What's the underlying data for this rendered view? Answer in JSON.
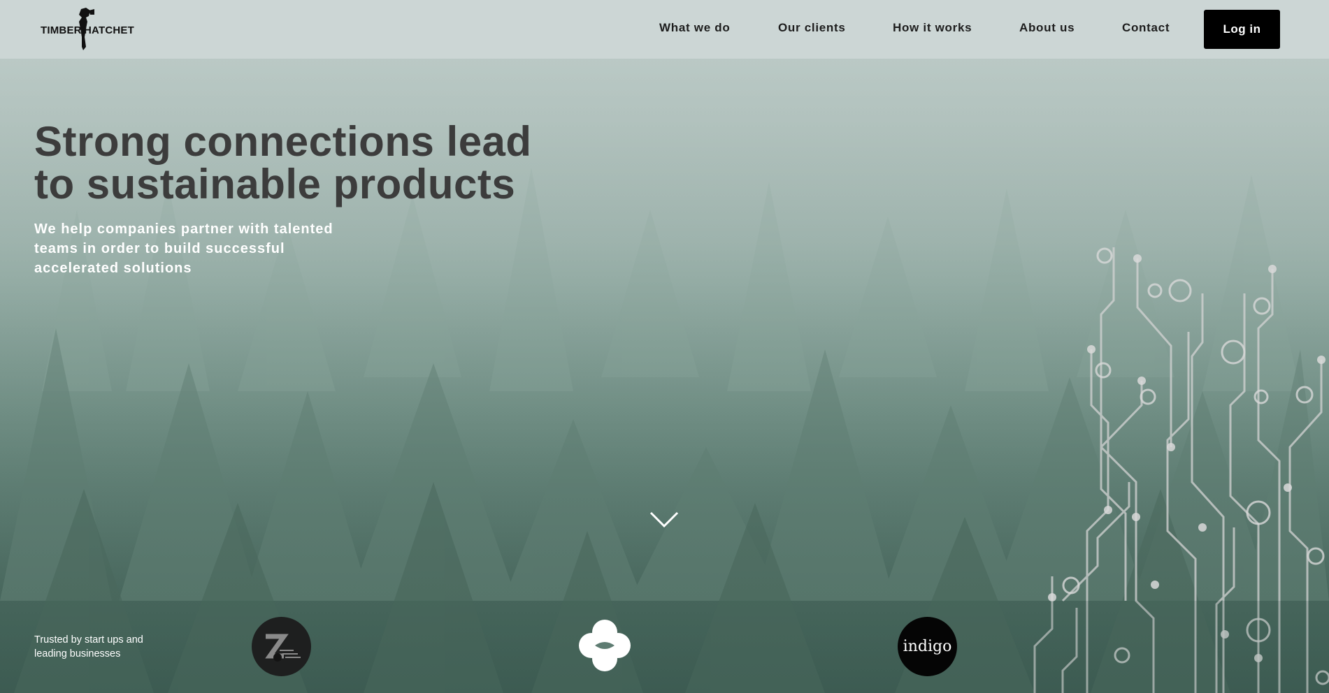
{
  "brand": {
    "logo_left": "TIMBER",
    "logo_right": "HATCHET"
  },
  "nav": {
    "links": [
      {
        "label": "What we do"
      },
      {
        "label": "Our clients"
      },
      {
        "label": "How it works"
      },
      {
        "label": "About us"
      },
      {
        "label": "Contact"
      }
    ],
    "login_label": "Log in"
  },
  "hero": {
    "headline": "Strong connections lead to sustainable products",
    "subheadline": "We help companies partner with talented teams in order to build successful accelerated solutions",
    "scroll_icon": "chevron-down-icon"
  },
  "trusted": {
    "text": "Trusted by start ups and leading businesses",
    "clients": [
      {
        "icon": "z-logo-icon"
      },
      {
        "icon": "clover-logo-icon"
      },
      {
        "name": "indigo"
      }
    ]
  },
  "colors": {
    "nav_bg": "#cdd7d6",
    "login_bg": "#000000",
    "headline": "#3c3c3c",
    "subheadline": "#ffffff"
  }
}
